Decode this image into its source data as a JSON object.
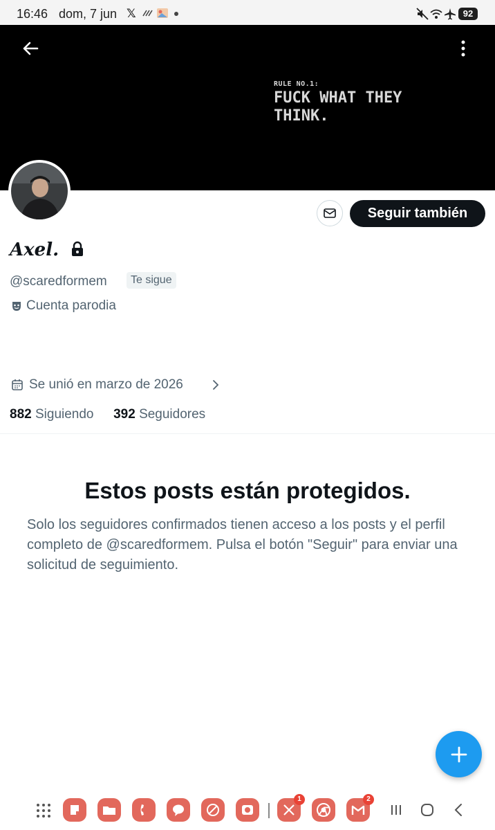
{
  "status_bar": {
    "time": "16:46",
    "date": "dom, 7 jun",
    "notif_x": "𝕏",
    "battery": "92"
  },
  "banner": {
    "line_small": "RULE NO.1:",
    "line_big": "FUCK WHAT THEY\nTHINK."
  },
  "profile": {
    "display_name": "Axel.",
    "handle": "@scaredformem",
    "follows_you": "Te sigue",
    "parody_label": "Cuenta parodia",
    "joined": "Se unió en marzo de 2026",
    "following_count": "882",
    "following_label": "Siguiendo",
    "followers_count": "392",
    "followers_label": "Seguidores"
  },
  "actions": {
    "follow_back": "Seguir también"
  },
  "protected": {
    "title": "Estos posts están protegidos.",
    "body": "Solo los seguidores confirmados tienen acceso a los posts y el perfil completo de @scaredformem. Pulsa el botón \"Seguir\" para enviar una solicitud de seguimiento."
  },
  "dock": {
    "x_badge": "1",
    "gmail_badge": "2"
  },
  "colors": {
    "accent": "#1d9bf0",
    "text_primary": "#0f1419",
    "text_secondary": "#536471",
    "dock_app": "#e2685c"
  }
}
